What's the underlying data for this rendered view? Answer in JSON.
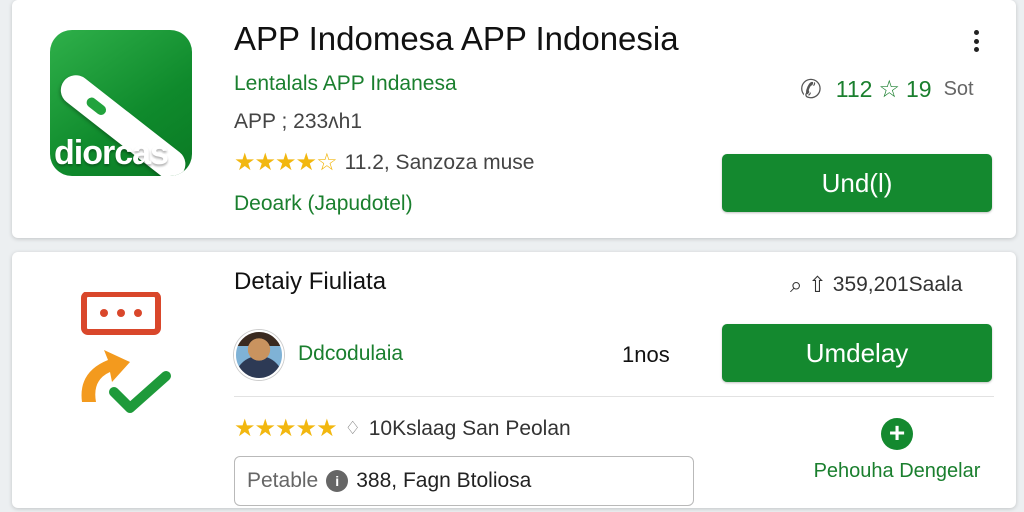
{
  "app": {
    "icon_text": "diorcas",
    "title": "APP Indomesa APP Indonesia",
    "developer": "Lentalals APP Indanesa",
    "app_id": "APP ; 233ʌh1",
    "stars": "★★★★☆",
    "rating_text": "11.2, Sanzoza muse",
    "status": "Deoark (Japudotel)",
    "stats": {
      "value1": "112",
      "value2": "19",
      "unit": "Sot"
    },
    "button_label": "Und(l)"
  },
  "detail": {
    "section_title": "Detaiy Fiuliata",
    "count": "359,201Saala",
    "developer": "Ddcodulaia",
    "size": "1nos",
    "button_label": "Umdelay",
    "stars": "★★★★★",
    "rating_text": "10Kslaag San Peolan",
    "input": {
      "label": "Petable",
      "value": "388, Fagn Btoliosa"
    },
    "add_label": "Pehouha Dengelar"
  },
  "icons": [
    "more-vert-icon",
    "phone-icon",
    "star-outline-icon",
    "search-icon",
    "upload-icon",
    "chat-icon",
    "checkmark-icon",
    "pin-icon",
    "info-icon",
    "plus-icon"
  ],
  "colors": {
    "accent_green": "#14892f",
    "text_green": "#1a7f2e",
    "star_yellow": "#f2b70f",
    "chat_red": "#d9472b",
    "arrow_orange": "#f39a1e"
  }
}
